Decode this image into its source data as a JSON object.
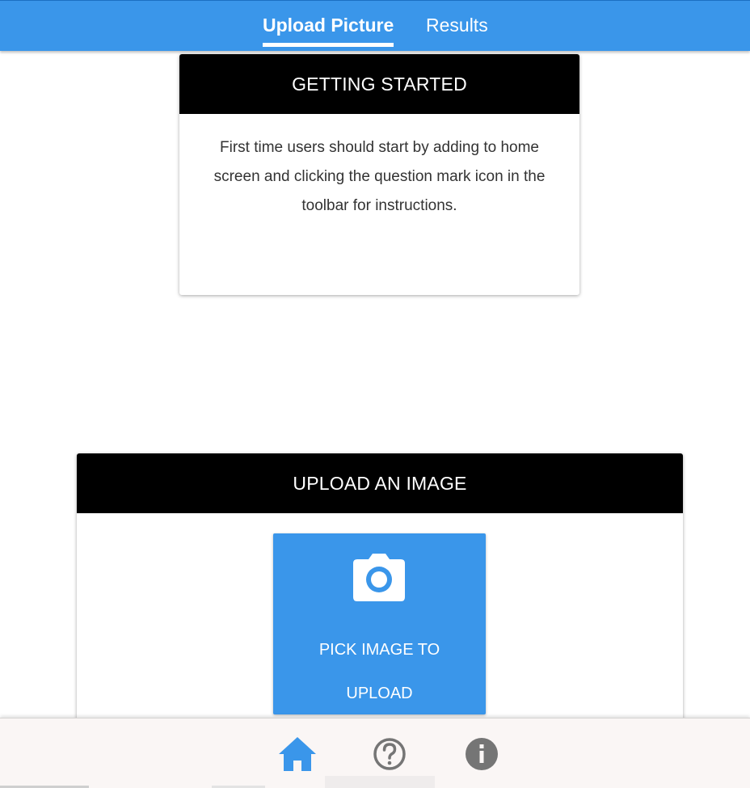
{
  "tabs": {
    "upload_label": "Upload Picture",
    "results_label": "Results"
  },
  "getting_started": {
    "title": "GETTING STARTED",
    "body": "First time users should start by adding to home screen and clicking the question mark icon in the toolbar for instructions."
  },
  "upload": {
    "title": "UPLOAD AN IMAGE",
    "button_label": "PICK IMAGE TO UPLOAD",
    "button_icon": "camera-icon"
  },
  "toolbar": {
    "items": [
      {
        "icon": "home-icon",
        "active": true
      },
      {
        "icon": "help-icon",
        "active": false
      },
      {
        "icon": "info-icon",
        "active": false
      }
    ]
  },
  "colors": {
    "accent": "#3a96ea",
    "header_bg": "#000000",
    "toolbar_bg": "#faf6f5",
    "icon_inactive": "#757575"
  }
}
